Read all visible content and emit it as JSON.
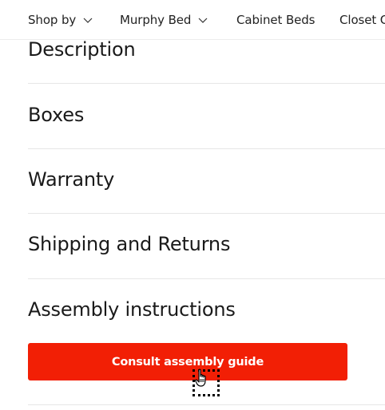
{
  "nav": {
    "items": [
      {
        "label": "Shop by",
        "has_dropdown": true
      },
      {
        "label": "Murphy Bed",
        "has_dropdown": true
      },
      {
        "label": "Cabinet Beds",
        "has_dropdown": false
      },
      {
        "label": "Closet C",
        "has_dropdown": false
      }
    ],
    "chevron_icon": "chevron-down-icon"
  },
  "accordion": {
    "sections": [
      {
        "label": "Description"
      },
      {
        "label": "Boxes"
      },
      {
        "label": "Warranty"
      },
      {
        "label": "Shipping and Returns"
      },
      {
        "label": "Assembly instructions"
      }
    ]
  },
  "assembly": {
    "button_label": "Consult assembly guide"
  },
  "colors": {
    "accent": "#f21f05",
    "text": "#1a1a1a",
    "divider": "#e6e6e6"
  },
  "cursor": {
    "icon": "hand-pointer-icon"
  }
}
